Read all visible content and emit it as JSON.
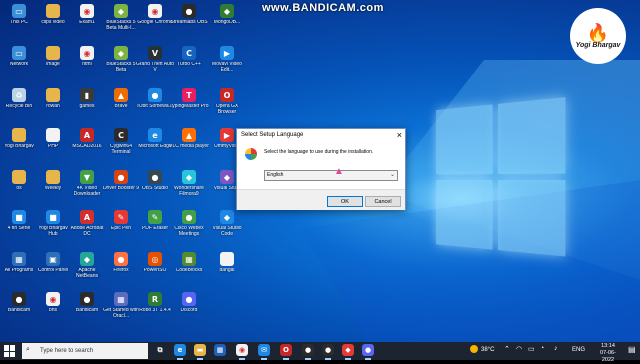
{
  "watermark": "www.BANDICAM.com",
  "brand": {
    "text": "Yogi Bhargav"
  },
  "desktop_icons": [
    {
      "label": "This PC",
      "color": "#3a8fd8",
      "icon": "computer-icon",
      "glyph": "▭",
      "col": 0,
      "row": 0
    },
    {
      "label": "Network",
      "color": "#3a8fd8",
      "icon": "network-icon",
      "glyph": "▭",
      "col": 0,
      "row": 1
    },
    {
      "label": "Recycle Bin",
      "color": "#bcd3e6",
      "icon": "recycle-bin-icon",
      "glyph": "♻",
      "col": 0,
      "row": 2
    },
    {
      "label": "Yogi Bhargav",
      "color": "#e6b54c",
      "icon": "folder-icon",
      "glyph": "",
      "col": 0,
      "row": 3
    },
    {
      "label": "os",
      "color": "#e6b54c",
      "icon": "folder-icon",
      "glyph": "",
      "col": 0,
      "row": 4
    },
    {
      "label": "4 tin Serie",
      "color": "#1e88e5",
      "icon": "app-icon",
      "glyph": "■",
      "col": 0,
      "row": 5
    },
    {
      "label": "All Programs",
      "color": "#2d6fb8",
      "icon": "programs-icon",
      "glyph": "▦",
      "col": 0,
      "row": 6
    },
    {
      "label": "Bandicam",
      "color": "#2b2b2b",
      "icon": "bandicam-icon",
      "glyph": "●",
      "col": 0,
      "row": 7
    },
    {
      "label": "clips video",
      "color": "#e6b54c",
      "icon": "folder-icon",
      "glyph": "",
      "col": 1,
      "row": 0
    },
    {
      "label": "image",
      "color": "#e6b54c",
      "icon": "folder-icon",
      "glyph": "",
      "col": 1,
      "row": 1
    },
    {
      "label": "rowan",
      "color": "#e6b54c",
      "icon": "folder-icon",
      "glyph": "",
      "col": 1,
      "row": 2
    },
    {
      "label": "PHP",
      "color": "#f2f2f2",
      "icon": "file-icon",
      "glyph": "",
      "col": 1,
      "row": 3
    },
    {
      "label": "Weekly",
      "color": "#e6b54c",
      "icon": "folder-icon",
      "glyph": "",
      "col": 1,
      "row": 4
    },
    {
      "label": "Yogi Bhargav Hub",
      "color": "#1e88e5",
      "icon": "app-icon",
      "glyph": "■",
      "col": 1,
      "row": 5
    },
    {
      "label": "Control Panel",
      "color": "#2d6fb8",
      "icon": "control-panel-icon",
      "glyph": "▣",
      "col": 1,
      "row": 6
    },
    {
      "label": "bns",
      "color": "#f2f2f2",
      "icon": "chrome-icon",
      "glyph": "◉",
      "col": 1,
      "row": 7
    },
    {
      "label": "Exam1",
      "color": "#f2f2f2",
      "icon": "chrome-icon",
      "glyph": "◉",
      "col": 2,
      "row": 0
    },
    {
      "label": "html",
      "color": "#f2f2f2",
      "icon": "chrome-icon",
      "glyph": "◉",
      "col": 2,
      "row": 1
    },
    {
      "label": "games",
      "color": "#3a3a3a",
      "icon": "games-icon",
      "glyph": "▮",
      "col": 2,
      "row": 2
    },
    {
      "label": "MSCAD2016",
      "color": "#c62828",
      "icon": "app-icon",
      "glyph": "A",
      "col": 2,
      "row": 3
    },
    {
      "label": "4K Video Downloader",
      "color": "#43a047",
      "icon": "app-icon",
      "glyph": "▼",
      "col": 2,
      "row": 4
    },
    {
      "label": "Adobe Acrobat DC",
      "color": "#d32f2f",
      "icon": "acrobat-icon",
      "glyph": "A",
      "col": 2,
      "row": 5
    },
    {
      "label": "Apache NetBeans",
      "color": "#26a69a",
      "icon": "netbeans-icon",
      "glyph": "◆",
      "col": 2,
      "row": 6
    },
    {
      "label": "Bandicam",
      "color": "#2b2b2b",
      "icon": "bandicam-icon",
      "glyph": "●",
      "col": 2,
      "row": 7
    },
    {
      "label": "BlueStacks 5 Beta Multi-I...",
      "color": "#7cb342",
      "icon": "bluestacks-icon",
      "glyph": "◆",
      "col": 3,
      "row": 0
    },
    {
      "label": "BlueStacks 5 Beta",
      "color": "#7cb342",
      "icon": "bluestacks-icon",
      "glyph": "◆",
      "col": 3,
      "row": 1
    },
    {
      "label": "Brave",
      "color": "#ef6c00",
      "icon": "brave-icon",
      "glyph": "▲",
      "col": 3,
      "row": 2
    },
    {
      "label": "Cygwin64 Terminal",
      "color": "#2b2b2b",
      "icon": "terminal-icon",
      "glyph": "C",
      "col": 3,
      "row": 3
    },
    {
      "label": "Driver Booster 9",
      "color": "#d84315",
      "icon": "app-icon",
      "glyph": "●",
      "col": 3,
      "row": 4
    },
    {
      "label": "Epic Pen",
      "color": "#e53935",
      "icon": "app-icon",
      "glyph": "✎",
      "col": 3,
      "row": 5
    },
    {
      "label": "Firefox",
      "color": "#ff7043",
      "icon": "firefox-icon",
      "glyph": "●",
      "col": 3,
      "row": 6
    },
    {
      "label": "Get Started with Oracl...",
      "color": "#5c6bc0",
      "icon": "app-icon",
      "glyph": "▦",
      "col": 3,
      "row": 7
    },
    {
      "label": "Google Chrome",
      "color": "#f2f2f2",
      "icon": "chrome-icon",
      "glyph": "◉",
      "col": 4,
      "row": 0
    },
    {
      "label": "Grand Theft Auto V",
      "color": "#263238",
      "icon": "app-icon",
      "glyph": "V",
      "col": 4,
      "row": 1
    },
    {
      "label": "IObit Somewa...",
      "color": "#1e88e5",
      "icon": "app-icon",
      "glyph": "●",
      "col": 4,
      "row": 2
    },
    {
      "label": "Microsoft Edge",
      "color": "#1e88e5",
      "icon": "edge-icon",
      "glyph": "e",
      "col": 4,
      "row": 3
    },
    {
      "label": "OBS Studio",
      "color": "#37474f",
      "icon": "obs-icon",
      "glyph": "●",
      "col": 4,
      "row": 4
    },
    {
      "label": "PDF Eraser",
      "color": "#43a047",
      "icon": "app-icon",
      "glyph": "✎",
      "col": 4,
      "row": 5
    },
    {
      "label": "PowerISO",
      "color": "#e65100",
      "icon": "app-icon",
      "glyph": "◎",
      "col": 4,
      "row": 6
    },
    {
      "label": "Robo 3T 1.4.4",
      "color": "#2e7d32",
      "icon": "app-icon",
      "glyph": "R",
      "col": 4,
      "row": 7
    },
    {
      "label": "Streamlabs OBS",
      "color": "#2b2b2b",
      "icon": "app-icon",
      "glyph": "●",
      "col": 5,
      "row": 0
    },
    {
      "label": "Turbo C++",
      "color": "#1565c0",
      "icon": "app-icon",
      "glyph": "C",
      "col": 5,
      "row": 1
    },
    {
      "label": "TypingMaster Pro",
      "color": "#e91e63",
      "icon": "app-icon",
      "glyph": "T",
      "col": 5,
      "row": 2
    },
    {
      "label": "VLC media player",
      "color": "#ff6f00",
      "icon": "vlc-icon",
      "glyph": "▲",
      "col": 5,
      "row": 3
    },
    {
      "label": "Wondershare Filmora9",
      "color": "#26c6da",
      "icon": "app-icon",
      "glyph": "◆",
      "col": 5,
      "row": 4
    },
    {
      "label": "Cisco Webex Meetings",
      "color": "#43a047",
      "icon": "app-icon",
      "glyph": "●",
      "col": 5,
      "row": 5
    },
    {
      "label": "CodeBlocks",
      "color": "#558b2f",
      "icon": "app-icon",
      "glyph": "▦",
      "col": 5,
      "row": 6
    },
    {
      "label": "Discord",
      "color": "#5865f2",
      "icon": "discord-icon",
      "glyph": "●",
      "col": 5,
      "row": 7
    },
    {
      "label": "MongoDB...",
      "color": "#2e7d32",
      "icon": "app-icon",
      "glyph": "◆",
      "col": 6,
      "row": 0
    },
    {
      "label": "Movavi Video Edit...",
      "color": "#1e88e5",
      "icon": "app-icon",
      "glyph": "▶",
      "col": 6,
      "row": 1
    },
    {
      "label": "Opera GX Browser",
      "color": "#c62828",
      "icon": "opera-icon",
      "glyph": "O",
      "col": 6,
      "row": 2
    },
    {
      "label": "UmmyVid...",
      "color": "#e53935",
      "icon": "app-icon",
      "glyph": "▶",
      "col": 6,
      "row": 3
    },
    {
      "label": "Visual Stu...",
      "color": "#7e57c2",
      "icon": "app-icon",
      "glyph": "◆",
      "col": 6,
      "row": 4
    },
    {
      "label": "Visual Studio Code",
      "color": "#1e88e5",
      "icon": "vscode-icon",
      "glyph": "◆",
      "col": 6,
      "row": 5
    },
    {
      "label": "dangal",
      "color": "#f2f2f2",
      "icon": "file-icon",
      "glyph": "",
      "col": 6,
      "row": 6
    }
  ],
  "dialog": {
    "title": "Select Setup Language",
    "close": "×",
    "prompt": "Select the language to use during the installation.",
    "selected_language": "English",
    "ok_label": "OK",
    "cancel_label": "Cancel"
  },
  "taskbar": {
    "search_placeholder": "Type here to search",
    "apps": [
      {
        "name": "task-view",
        "color": "#1b2430",
        "glyph": "⧉"
      },
      {
        "name": "edge",
        "color": "#1e88e5",
        "glyph": "e"
      },
      {
        "name": "file-explorer",
        "color": "#e6b54c",
        "glyph": "▬"
      },
      {
        "name": "store",
        "color": "#1e5fb8",
        "glyph": "▦"
      },
      {
        "name": "chrome",
        "color": "#f2f2f2",
        "glyph": "◉"
      },
      {
        "name": "mail",
        "color": "#1e88e5",
        "glyph": "✉"
      },
      {
        "name": "opera",
        "color": "#c62828",
        "glyph": "O"
      },
      {
        "name": "app",
        "color": "#2b2b2b",
        "glyph": "●"
      },
      {
        "name": "bandicam",
        "color": "#2b2b2b",
        "glyph": "●"
      },
      {
        "name": "setup",
        "color": "#e53935",
        "glyph": "◆"
      },
      {
        "name": "app2",
        "color": "#5865f2",
        "glyph": "●"
      }
    ],
    "weather": "38°C",
    "language": "ENG",
    "time": "13:14",
    "date": "07-06-2022"
  }
}
